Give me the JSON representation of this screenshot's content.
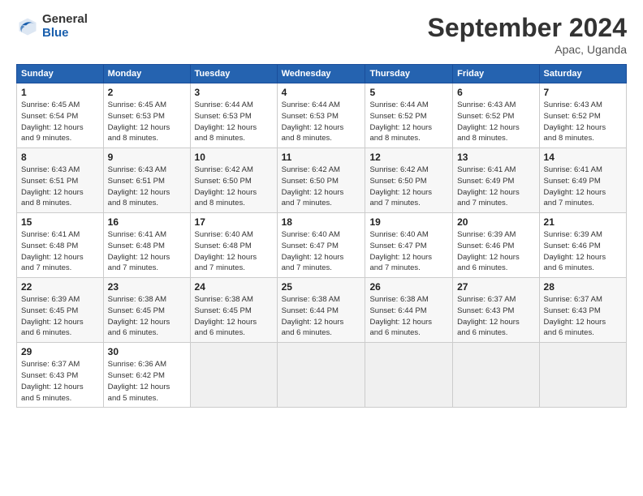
{
  "header": {
    "logo_general": "General",
    "logo_blue": "Blue",
    "month_title": "September 2024",
    "location": "Apac, Uganda"
  },
  "weekdays": [
    "Sunday",
    "Monday",
    "Tuesday",
    "Wednesday",
    "Thursday",
    "Friday",
    "Saturday"
  ],
  "weeks": [
    [
      {
        "day": "1",
        "info": "Sunrise: 6:45 AM\nSunset: 6:54 PM\nDaylight: 12 hours\nand 9 minutes."
      },
      {
        "day": "2",
        "info": "Sunrise: 6:45 AM\nSunset: 6:53 PM\nDaylight: 12 hours\nand 8 minutes."
      },
      {
        "day": "3",
        "info": "Sunrise: 6:44 AM\nSunset: 6:53 PM\nDaylight: 12 hours\nand 8 minutes."
      },
      {
        "day": "4",
        "info": "Sunrise: 6:44 AM\nSunset: 6:53 PM\nDaylight: 12 hours\nand 8 minutes."
      },
      {
        "day": "5",
        "info": "Sunrise: 6:44 AM\nSunset: 6:52 PM\nDaylight: 12 hours\nand 8 minutes."
      },
      {
        "day": "6",
        "info": "Sunrise: 6:43 AM\nSunset: 6:52 PM\nDaylight: 12 hours\nand 8 minutes."
      },
      {
        "day": "7",
        "info": "Sunrise: 6:43 AM\nSunset: 6:52 PM\nDaylight: 12 hours\nand 8 minutes."
      }
    ],
    [
      {
        "day": "8",
        "info": "Sunrise: 6:43 AM\nSunset: 6:51 PM\nDaylight: 12 hours\nand 8 minutes."
      },
      {
        "day": "9",
        "info": "Sunrise: 6:43 AM\nSunset: 6:51 PM\nDaylight: 12 hours\nand 8 minutes."
      },
      {
        "day": "10",
        "info": "Sunrise: 6:42 AM\nSunset: 6:50 PM\nDaylight: 12 hours\nand 8 minutes."
      },
      {
        "day": "11",
        "info": "Sunrise: 6:42 AM\nSunset: 6:50 PM\nDaylight: 12 hours\nand 7 minutes."
      },
      {
        "day": "12",
        "info": "Sunrise: 6:42 AM\nSunset: 6:50 PM\nDaylight: 12 hours\nand 7 minutes."
      },
      {
        "day": "13",
        "info": "Sunrise: 6:41 AM\nSunset: 6:49 PM\nDaylight: 12 hours\nand 7 minutes."
      },
      {
        "day": "14",
        "info": "Sunrise: 6:41 AM\nSunset: 6:49 PM\nDaylight: 12 hours\nand 7 minutes."
      }
    ],
    [
      {
        "day": "15",
        "info": "Sunrise: 6:41 AM\nSunset: 6:48 PM\nDaylight: 12 hours\nand 7 minutes."
      },
      {
        "day": "16",
        "info": "Sunrise: 6:41 AM\nSunset: 6:48 PM\nDaylight: 12 hours\nand 7 minutes."
      },
      {
        "day": "17",
        "info": "Sunrise: 6:40 AM\nSunset: 6:48 PM\nDaylight: 12 hours\nand 7 minutes."
      },
      {
        "day": "18",
        "info": "Sunrise: 6:40 AM\nSunset: 6:47 PM\nDaylight: 12 hours\nand 7 minutes."
      },
      {
        "day": "19",
        "info": "Sunrise: 6:40 AM\nSunset: 6:47 PM\nDaylight: 12 hours\nand 7 minutes."
      },
      {
        "day": "20",
        "info": "Sunrise: 6:39 AM\nSunset: 6:46 PM\nDaylight: 12 hours\nand 6 minutes."
      },
      {
        "day": "21",
        "info": "Sunrise: 6:39 AM\nSunset: 6:46 PM\nDaylight: 12 hours\nand 6 minutes."
      }
    ],
    [
      {
        "day": "22",
        "info": "Sunrise: 6:39 AM\nSunset: 6:45 PM\nDaylight: 12 hours\nand 6 minutes."
      },
      {
        "day": "23",
        "info": "Sunrise: 6:38 AM\nSunset: 6:45 PM\nDaylight: 12 hours\nand 6 minutes."
      },
      {
        "day": "24",
        "info": "Sunrise: 6:38 AM\nSunset: 6:45 PM\nDaylight: 12 hours\nand 6 minutes."
      },
      {
        "day": "25",
        "info": "Sunrise: 6:38 AM\nSunset: 6:44 PM\nDaylight: 12 hours\nand 6 minutes."
      },
      {
        "day": "26",
        "info": "Sunrise: 6:38 AM\nSunset: 6:44 PM\nDaylight: 12 hours\nand 6 minutes."
      },
      {
        "day": "27",
        "info": "Sunrise: 6:37 AM\nSunset: 6:43 PM\nDaylight: 12 hours\nand 6 minutes."
      },
      {
        "day": "28",
        "info": "Sunrise: 6:37 AM\nSunset: 6:43 PM\nDaylight: 12 hours\nand 6 minutes."
      }
    ],
    [
      {
        "day": "29",
        "info": "Sunrise: 6:37 AM\nSunset: 6:43 PM\nDaylight: 12 hours\nand 5 minutes."
      },
      {
        "day": "30",
        "info": "Sunrise: 6:36 AM\nSunset: 6:42 PM\nDaylight: 12 hours\nand 5 minutes."
      },
      {
        "day": "",
        "info": ""
      },
      {
        "day": "",
        "info": ""
      },
      {
        "day": "",
        "info": ""
      },
      {
        "day": "",
        "info": ""
      },
      {
        "day": "",
        "info": ""
      }
    ]
  ]
}
